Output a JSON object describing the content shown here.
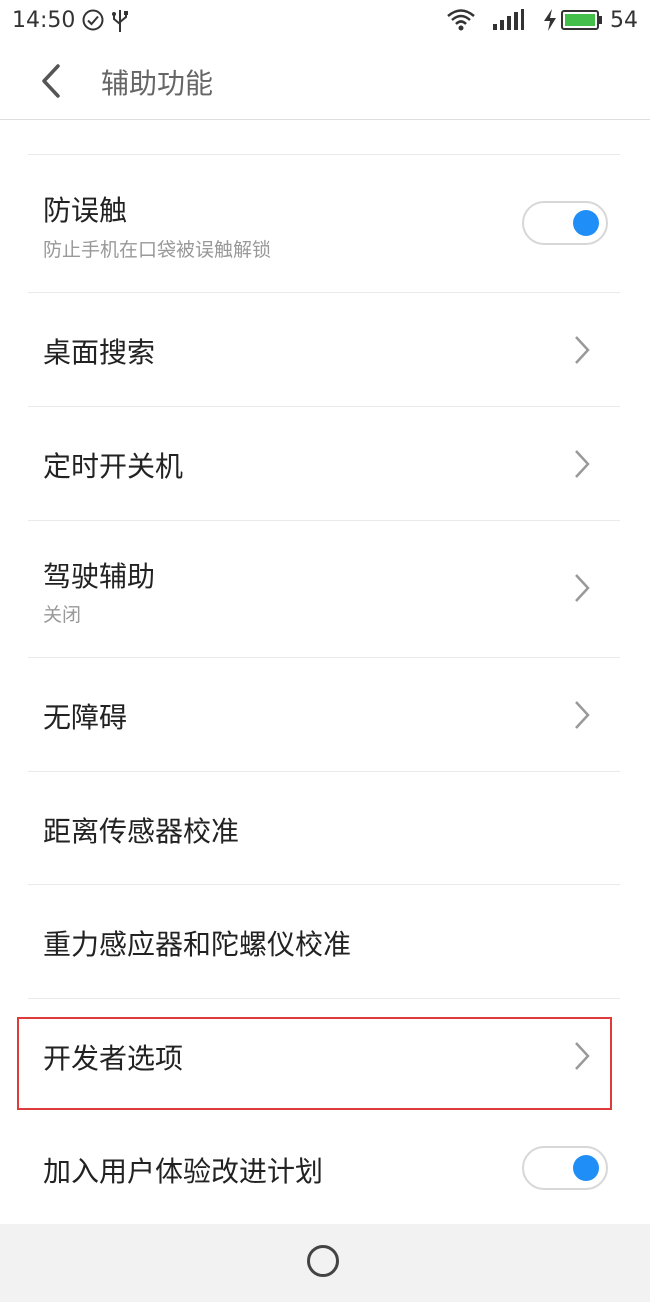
{
  "status_bar": {
    "time": "14:50",
    "battery_level": "54",
    "icons": [
      "check-circle-icon",
      "usb-icon",
      "wifi-icon",
      "signal-icon",
      "charging-icon",
      "battery-icon"
    ]
  },
  "header": {
    "title": "辅助功能",
    "back_icon": "chevron-left-icon"
  },
  "settings": {
    "items": [
      {
        "title": "防误触",
        "subtitle": "防止手机在口袋被误触解锁",
        "control": "toggle",
        "checked": true
      },
      {
        "title": "桌面搜索",
        "control": "chevron"
      },
      {
        "title": "定时开关机",
        "control": "chevron"
      },
      {
        "title": "驾驶辅助",
        "subtitle": "关闭",
        "control": "chevron"
      },
      {
        "title": "无障碍",
        "control": "chevron"
      },
      {
        "title": "距离传感器校准",
        "control": "none"
      },
      {
        "title": "重力感应器和陀螺仪校准",
        "control": "none"
      },
      {
        "title": "开发者选项",
        "control": "chevron",
        "highlighted": true
      },
      {
        "title": "加入用户体验改进计划",
        "control": "toggle",
        "checked": true
      }
    ]
  },
  "colors": {
    "accent": "#1f8ff7",
    "highlight_border": "#e03b3b"
  },
  "bottom_bar": {
    "home_icon": "home-circle-icon"
  }
}
